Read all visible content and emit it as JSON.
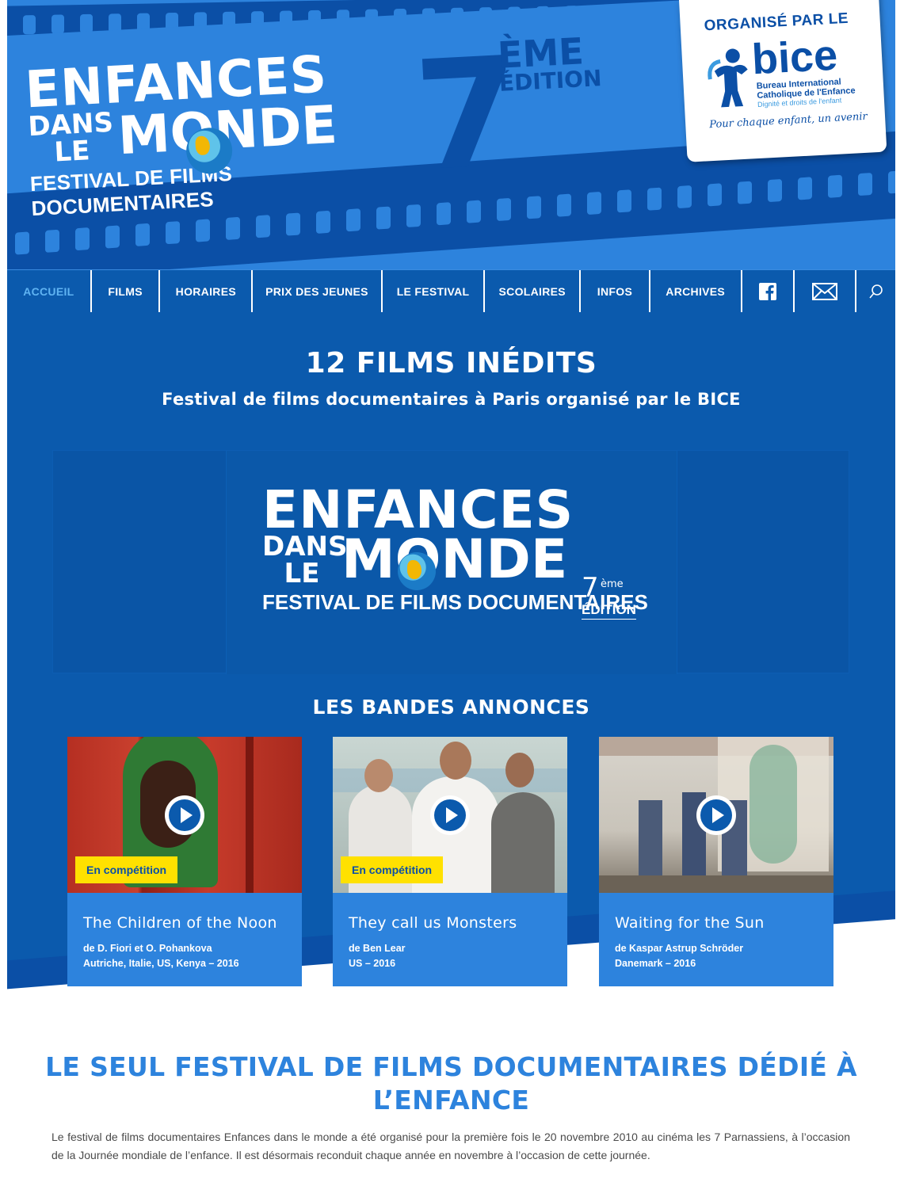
{
  "header": {
    "logo": {
      "line1": "ENFANCES",
      "dans": "DANS",
      "le": "LE",
      "monde": "MONDE",
      "tagline": "FESTIVAL DE FILMS DOCUMENTAIRES"
    },
    "edition": {
      "number": "7",
      "suffix": "ÈME",
      "word": "ÉDITION"
    },
    "organizer": {
      "title": "ORGANISÉ PAR LE",
      "name": "bice",
      "line1": "Bureau International",
      "line2": "Catholique de l'Enfance",
      "line3": "Dignité et droits de l'enfant",
      "slogan": "Pour chaque enfant, un avenir"
    }
  },
  "nav": {
    "items": [
      {
        "label": "ACCUEIL"
      },
      {
        "label": "FILMS"
      },
      {
        "label": "HORAIRES"
      },
      {
        "label": "PRIX DES JEUNES"
      },
      {
        "label": "LE FESTIVAL"
      },
      {
        "label": "SCOLAIRES"
      },
      {
        "label": "INFOS"
      },
      {
        "label": "ARCHIVES"
      }
    ],
    "active": "ACCUEIL"
  },
  "hero": {
    "title": "12 FILMS INÉDITS",
    "subtitle": "Festival de films documentaires à Paris organisé par le BICE"
  },
  "video_logo": {
    "line1": "ENFANCES",
    "dans": "DANS",
    "le": "LE",
    "monde": "MONDE",
    "tagline": "FESTIVAL DE FILMS DOCUMENTAIRES",
    "edition_number": "7",
    "edition_sup": "ème",
    "edition_word": "ÉDITION"
  },
  "trailers": {
    "title": "LES BANDES ANNONCES",
    "cards": [
      {
        "title": "The Children of the Noon",
        "by": "de D. Fiori et O. Pohankova",
        "meta": "Autriche, Italie, US, Kenya – 2016",
        "badge": "En compétition"
      },
      {
        "title": "They call us Monsters",
        "by": "de Ben Lear",
        "meta": "US – 2016",
        "badge": "En compétition"
      },
      {
        "title": "Waiting for the Sun",
        "by": "de Kaspar Astrup Schröder",
        "meta": "Danemark – 2016",
        "badge": ""
      }
    ]
  },
  "about": {
    "title_line1": "LE SEUL FESTIVAL DE FILMS DOCUMENTAIRES DÉDIÉ À",
    "title_line2": "L’ENFANCE",
    "paragraph": "Le festival de films documentaires Enfances dans le monde a été organisé pour la première fois le 20 novembre 2010 au cinéma les 7 Parnassiens, à l’occasion de la Journée mondiale de l’enfance. Il est désormais reconduit chaque année en novembre à l’occasion de cette journée."
  },
  "colors": {
    "brand_blue": "#0b5aad",
    "light_blue": "#2d83dd",
    "dark_blue": "#0b4fa6",
    "badge_yellow": "#ffe100",
    "active_nav": "#5fb3f2"
  },
  "icons": [
    "facebook-icon",
    "mail-icon",
    "search-icon",
    "play-icon",
    "globe-icon",
    "bice-child-icon"
  ]
}
